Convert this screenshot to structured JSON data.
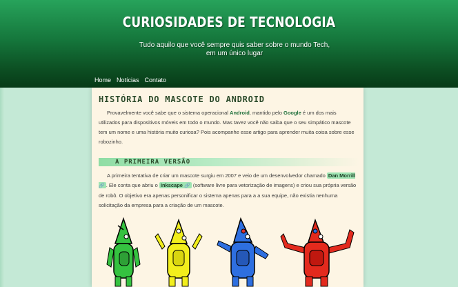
{
  "header": {
    "title": "Curiosidades de Tecnologia",
    "subtitle": "Tudo aquilo que você sempre quis saber sobre o mundo Tech, em um único lugar"
  },
  "nav": {
    "items": [
      {
        "label": "Home"
      },
      {
        "label": "Notícias"
      },
      {
        "label": "Contato"
      }
    ]
  },
  "post": {
    "title": "História do mascote do Android",
    "intro": {
      "t1": "Provavelmente você sabe que o sistema operacional ",
      "android": "Android",
      "t2": ", mantido pelo ",
      "google": "Google",
      "t3": " é um dos mais utilizados para dispositivos móveis em todo o mundo. Mas tavez você não saiba que o seu simpático mascote tem um nome e uma história muito curiosa? Pois acompanhe esse artigo para aprender muita coisa sobre esse robozinho."
    },
    "section": {
      "title": "A primeira versão",
      "t1": "A primeira tentativa de criar um mascote surgiu em 2007 e veio de um desenvolvedor chamado ",
      "link1": "Dan Morrill",
      "t2": ". Ele conta que abriu o ",
      "link2": "Inkscape",
      "t3": " (software livre para vetorização de imagens) e criou sua própria versão de robô. O objetivo era apenas personificar o sistema apenas para a a sua equipe, não existia nenhuma solicitação da empresa para a criação de um mascote."
    },
    "robots": [
      {
        "name": "green-robot",
        "color": "#35c240"
      },
      {
        "name": "yellow-robot",
        "color": "#f2ee1c"
      },
      {
        "name": "blue-robot",
        "color": "#2e6fe0"
      },
      {
        "name": "red-robot",
        "color": "#e32a1d"
      }
    ]
  },
  "colors": {
    "header_dark": "#073a17",
    "header_light": "#27a35b",
    "page_bg": "#c4e9d6",
    "content_bg": "#fdf5e4",
    "accent": "#9fe4b3"
  },
  "icons": {
    "external_link": "link-icon"
  }
}
